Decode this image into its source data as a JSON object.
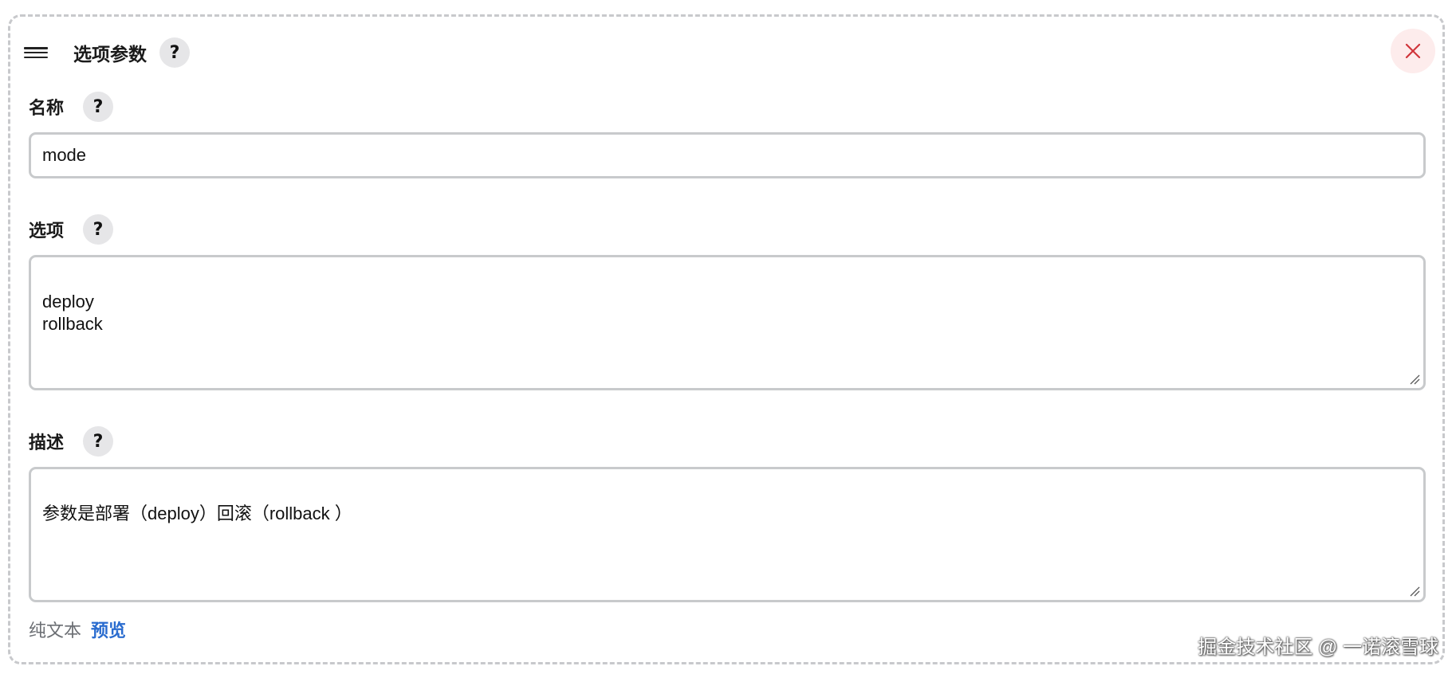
{
  "header": {
    "title": "选项参数",
    "help": "?"
  },
  "fields": {
    "name": {
      "label": "名称",
      "help": "?",
      "value": "mode"
    },
    "choices": {
      "label": "选项",
      "help": "?",
      "value": "deploy\nrollback"
    },
    "description": {
      "label": "描述",
      "help": "?",
      "value": "参数是部署（deploy）回滚（rollback ）"
    }
  },
  "footer": {
    "plain_text": "纯文本",
    "preview": "预览"
  },
  "watermark": "掘金技术社区 @ 一诺滚雪球",
  "colors": {
    "close_icon": "#d0353b",
    "close_bg": "#fdecec",
    "link": "#2a6ccf",
    "help_bg": "#e6e6e8"
  }
}
